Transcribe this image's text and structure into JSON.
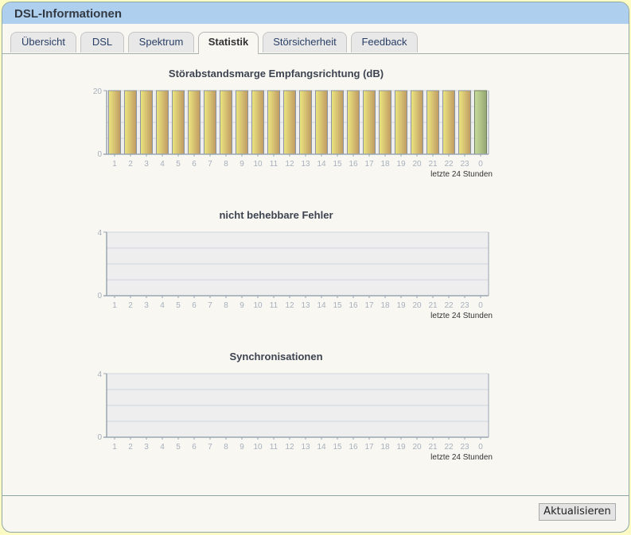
{
  "window": {
    "title": "DSL-Informationen"
  },
  "tabs": [
    {
      "label": "Übersicht",
      "active": false
    },
    {
      "label": "DSL",
      "active": false
    },
    {
      "label": "Spektrum",
      "active": false
    },
    {
      "label": "Statistik",
      "active": true
    },
    {
      "label": "Störsicherheit",
      "active": false
    },
    {
      "label": "Feedback",
      "active": false
    }
  ],
  "refresh_button": "Aktualisieren",
  "colors": {
    "header": "#aecfee",
    "bar_normal": "#d4b06a",
    "bar_current": "#a8bf80",
    "plot_bg": "#eeeeee"
  },
  "chart_data": [
    {
      "type": "bar",
      "title": "Störabstandsmarge Empfangsrichtung (dB)",
      "xlabel": "letzte 24 Stunden",
      "ylabel": "",
      "categories": [
        "1",
        "2",
        "3",
        "4",
        "5",
        "6",
        "7",
        "8",
        "9",
        "10",
        "11",
        "12",
        "13",
        "14",
        "15",
        "16",
        "17",
        "18",
        "19",
        "20",
        "21",
        "22",
        "23",
        "0"
      ],
      "values": [
        20,
        20,
        20,
        20,
        20,
        20,
        20,
        20,
        20,
        20,
        20,
        20,
        20,
        20,
        20,
        20,
        20,
        20,
        20,
        20,
        20,
        20,
        20,
        20
      ],
      "ylim": [
        0,
        20
      ],
      "yticks": [
        "0",
        "20"
      ],
      "grid": true
    },
    {
      "type": "bar",
      "title": "nicht behebbare Fehler",
      "xlabel": "letzte 24 Stunden",
      "ylabel": "",
      "categories": [
        "1",
        "2",
        "3",
        "4",
        "5",
        "6",
        "7",
        "8",
        "9",
        "10",
        "11",
        "12",
        "13",
        "14",
        "15",
        "16",
        "17",
        "18",
        "19",
        "20",
        "21",
        "22",
        "23",
        "0"
      ],
      "values": [
        0,
        0,
        0,
        0,
        0,
        0,
        0,
        0,
        0,
        0,
        0,
        0,
        0,
        0,
        0,
        0,
        0,
        0,
        0,
        0,
        0,
        0,
        0,
        0
      ],
      "ylim": [
        0,
        4
      ],
      "yticks": [
        "0",
        "4"
      ],
      "grid": true
    },
    {
      "type": "bar",
      "title": "Synchronisationen",
      "xlabel": "letzte 24 Stunden",
      "ylabel": "",
      "categories": [
        "1",
        "2",
        "3",
        "4",
        "5",
        "6",
        "7",
        "8",
        "9",
        "10",
        "11",
        "12",
        "13",
        "14",
        "15",
        "16",
        "17",
        "18",
        "19",
        "20",
        "21",
        "22",
        "23",
        "0"
      ],
      "values": [
        0,
        0,
        0,
        0,
        0,
        0,
        0,
        0,
        0,
        0,
        0,
        0,
        0,
        0,
        0,
        0,
        0,
        0,
        0,
        0,
        0,
        0,
        0,
        0
      ],
      "ylim": [
        0,
        4
      ],
      "yticks": [
        "0",
        "4"
      ],
      "grid": true
    }
  ]
}
